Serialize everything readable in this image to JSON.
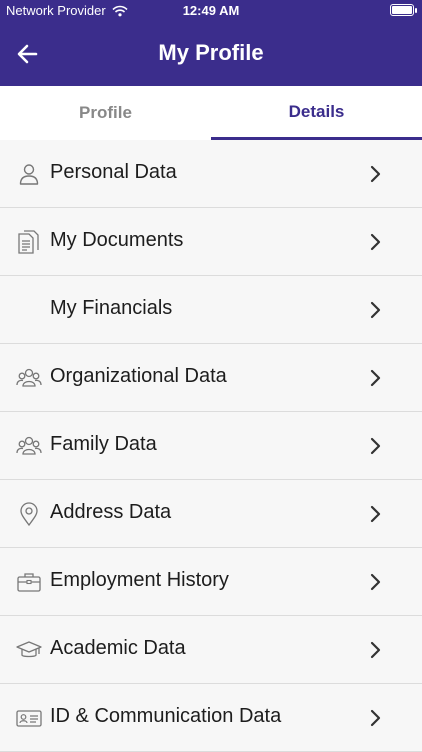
{
  "status_bar": {
    "carrier": "Network Provider",
    "time": "12:49 AM",
    "wifi_icon": "wifi-icon",
    "battery_icon": "battery-icon"
  },
  "header": {
    "title": "My Profile",
    "back_icon": "arrow-left-icon"
  },
  "tabs": [
    {
      "label": "Profile",
      "active": false
    },
    {
      "label": "Details",
      "active": true
    }
  ],
  "menu": [
    {
      "label": "Personal Data",
      "icon": "person-icon"
    },
    {
      "label": "My Documents",
      "icon": "documents-icon"
    },
    {
      "label": "My Financials",
      "icon": ""
    },
    {
      "label": "Organizational Data",
      "icon": "group-icon"
    },
    {
      "label": "Family Data",
      "icon": "family-icon"
    },
    {
      "label": "Address Data",
      "icon": "location-pin-icon"
    },
    {
      "label": "Employment History",
      "icon": "briefcase-icon"
    },
    {
      "label": "Academic Data",
      "icon": "graduation-cap-icon"
    },
    {
      "label": "ID & Communication Data",
      "icon": "id-card-icon"
    }
  ],
  "colors": {
    "primary": "#3b2d8c",
    "background": "#f7f7f7",
    "text": "#1d1d1d",
    "inactive_tab": "#888888"
  }
}
